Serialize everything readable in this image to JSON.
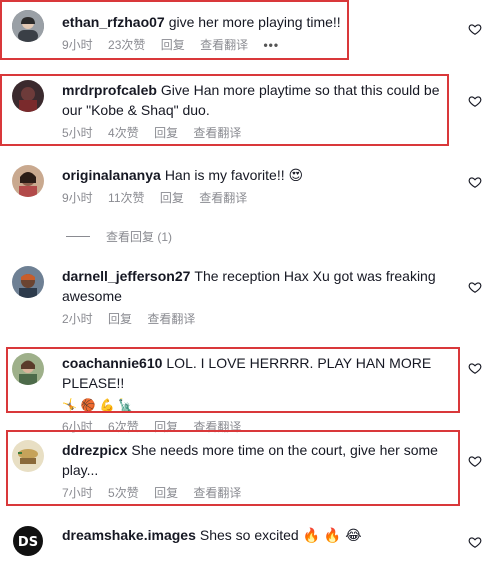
{
  "comments": [
    {
      "user": "ethan_rfzhao07",
      "text": "give her more playing time!!",
      "time": "9小时",
      "likes": "23次赞",
      "reply": "回复",
      "translate": "查看翻译",
      "more": "•••",
      "avatar_color": "#6b6f75"
    },
    {
      "user": "mrdrprofcaleb",
      "text": "Give Han more playtime so that this could be our \"Kobe & Shaq\" duo.",
      "time": "5小时",
      "likes": "4次赞",
      "reply": "回复",
      "translate": "查看翻译",
      "avatar_color": "#5a3b3a"
    },
    {
      "user": "originalananya",
      "text": "Han is my favorite!! 😍",
      "time": "9小时",
      "likes": "11次赞",
      "reply": "回复",
      "translate": "查看翻译",
      "avatar_color": "#8b5e4b"
    },
    {
      "user": "darnell_jefferson27",
      "text": "The reception Hax Xu got was freaking awesome",
      "time": "2小时",
      "reply": "回复",
      "translate": "查看翻译",
      "avatar_color": "#5d6a78"
    },
    {
      "user": "coachannie610",
      "text": "LOL. I LOVE HERRRR. PLAY HAN MORE PLEASE!!",
      "emojis": "🤸 🏀 💪 🗽",
      "time": "6小时",
      "likes": "6次赞",
      "reply": "回复",
      "translate": "查看翻译",
      "avatar_color": "#7c8a6a"
    },
    {
      "user": "ddrezpicx",
      "text": "She needs more time on the court, give her some play...",
      "time": "7小时",
      "likes": "5次赞",
      "reply": "回复",
      "translate": "查看翻译",
      "avatar_color": "#c9b98a"
    },
    {
      "user": "dreamshake.images",
      "text": "Shes so excited 🔥 🔥 😂",
      "avatar_color": "#1a1a1a",
      "avatar_text": "DS"
    }
  ],
  "view_replies": "查看回复 (1)",
  "colors": {
    "highlight": "#d9383a",
    "meta": "#8a8b91",
    "text": "#161823"
  }
}
